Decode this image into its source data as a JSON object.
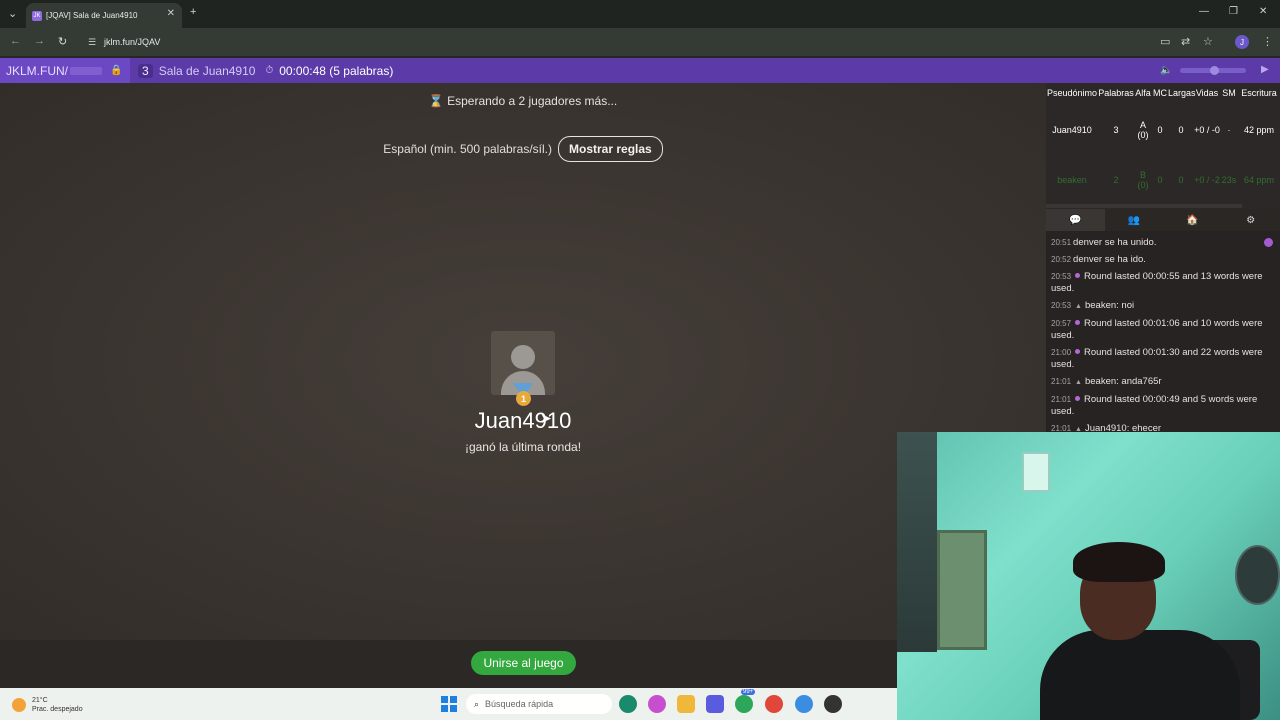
{
  "browser": {
    "tab_title": "[JQAV] Sala de Juan4910",
    "tab_favicon": "JK",
    "tab_close": "✕",
    "new_tab": "+",
    "url": "jklm.fun/JQAV",
    "window_min": "—",
    "window_max": "❐",
    "window_close": "✕",
    "profile_initial": "J"
  },
  "gamebar": {
    "brand": "JKLM.FUN/",
    "player_count": "3",
    "room_name": "Sala de Juan4910",
    "timer": "00:00:48 (5 palabras)"
  },
  "main": {
    "waiting": "Esperando a 2 jugadores más...",
    "language": "Español (min. 500 palabras/síl.)",
    "rules_button": "Mostrar reglas",
    "winner_rank": "1",
    "winner_name": "Juan4910",
    "winner_subtitle": "¡ganó la última ronda!",
    "join_button": "Unirse al juego"
  },
  "scoreboard": {
    "headers": [
      "Pseudónimo",
      "Palabras",
      "Alfa",
      "MC",
      "Largas",
      "Vidas",
      "SM",
      "Escritura"
    ],
    "rows": [
      [
        "Juan4910",
        "3",
        "A (0)",
        "0",
        "0",
        "+0 / -0",
        "·",
        "42 ppm"
      ],
      [
        "beaken",
        "2",
        "B (0)",
        "0",
        "0",
        "+0 / -2",
        "23s",
        "64 ppm"
      ]
    ]
  },
  "panel_tabs": [
    "💬",
    "👥",
    "🏠",
    "⚙"
  ],
  "chat": [
    {
      "time": "20:51",
      "kind": "system",
      "text": "denver se ha unido."
    },
    {
      "time": "20:52",
      "kind": "system",
      "text": "denver se ha ido."
    },
    {
      "time": "20:53",
      "kind": "round",
      "text": "Round lasted 00:00:55 and 13 words were used."
    },
    {
      "time": "20:53",
      "kind": "user",
      "text": "beaken: noi"
    },
    {
      "time": "20:57",
      "kind": "round",
      "text": "Round lasted 00:01:06 and 10 words were used."
    },
    {
      "time": "21:00",
      "kind": "round",
      "text": "Round lasted 00:01:30 and 22 words were used."
    },
    {
      "time": "21:01",
      "kind": "user",
      "text": "beaken: anda765r"
    },
    {
      "time": "21:01",
      "kind": "round",
      "text": "Round lasted 00:00:49 and 5 words were used."
    },
    {
      "time": "21:01",
      "kind": "user",
      "text": "Juan4910: ehecer"
    }
  ],
  "taskbar": {
    "temp": "21°C",
    "weather": "Prac. despejado",
    "search_placeholder": "Búsqueda rápida",
    "badge": "99+"
  },
  "colors": {
    "gamebar": "#5c3ba8",
    "join": "#33a83f",
    "stage": "#3a3430"
  }
}
